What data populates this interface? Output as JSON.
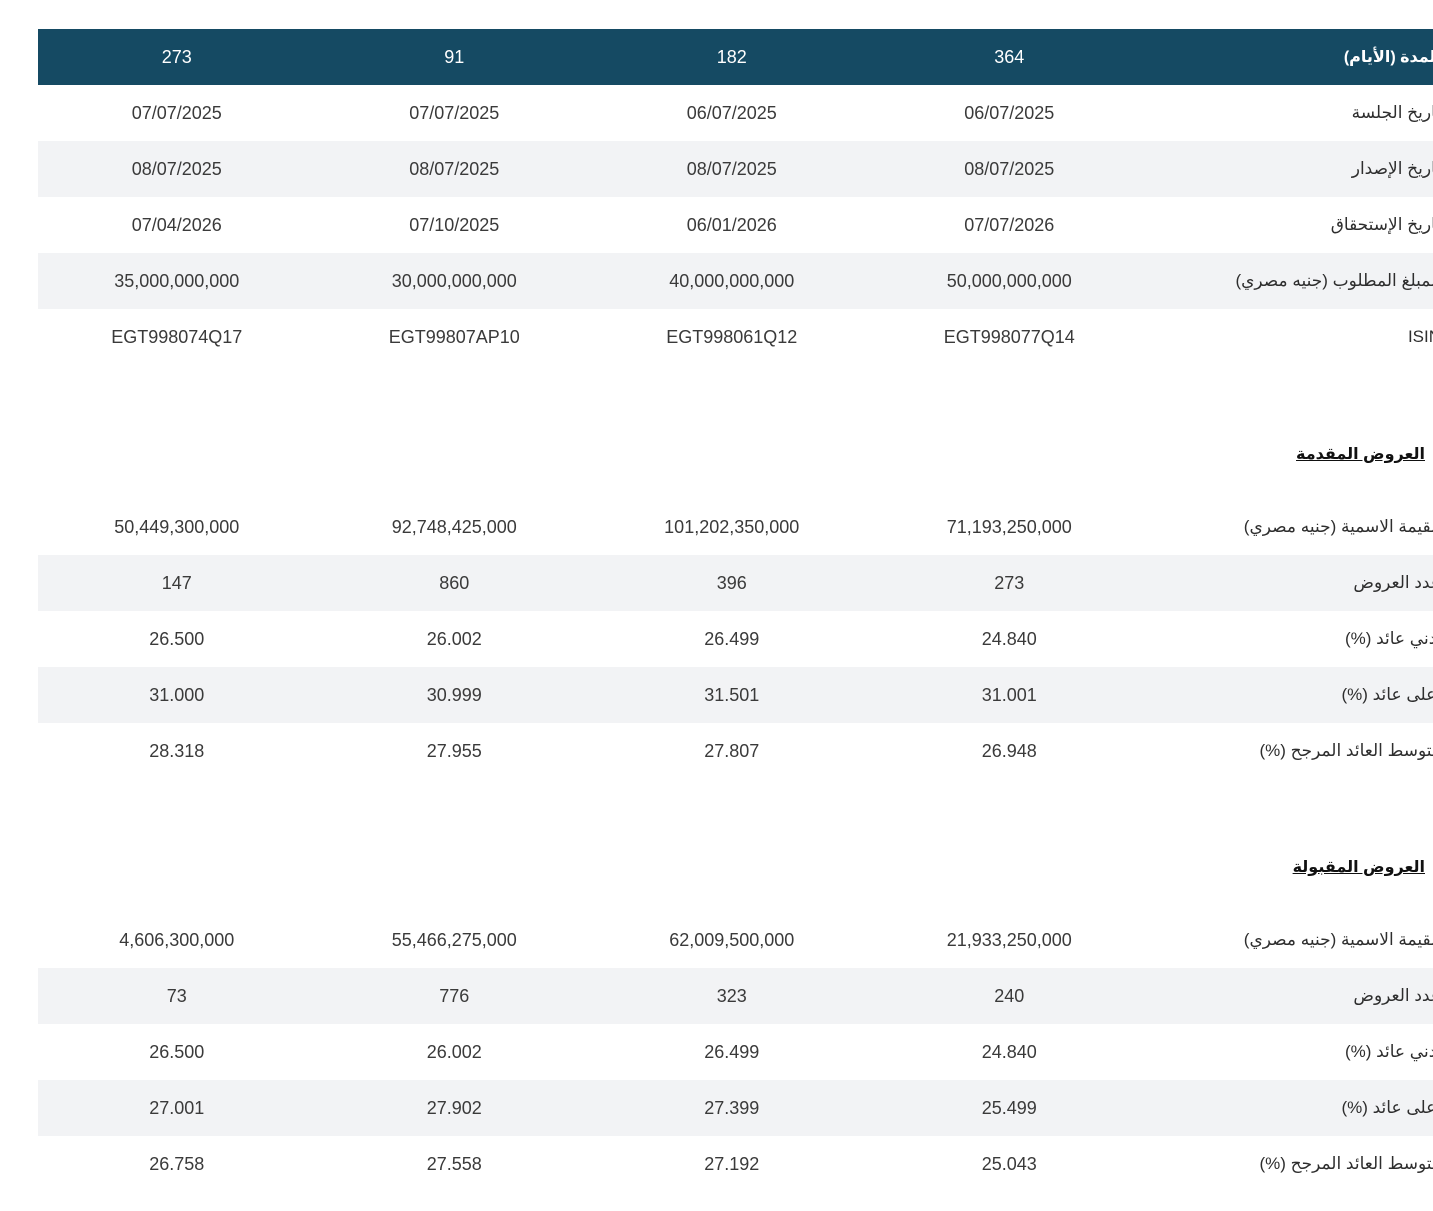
{
  "main_table": {
    "header": {
      "label": "المدة (الأيام)",
      "values": [
        "364",
        "182",
        "91",
        "273"
      ]
    },
    "rows": [
      {
        "label": "تاريخ الجلسة",
        "values": [
          "06/07/2025",
          "06/07/2025",
          "07/07/2025",
          "07/07/2025"
        ]
      },
      {
        "label": "تاريخ الإصدار",
        "values": [
          "08/07/2025",
          "08/07/2025",
          "08/07/2025",
          "08/07/2025"
        ]
      },
      {
        "label": "تاريخ الإستحقاق",
        "values": [
          "07/07/2026",
          "06/01/2026",
          "07/10/2025",
          "07/04/2026"
        ]
      },
      {
        "label": "المبلغ المطلوب (جنيه مصري)",
        "values": [
          "50,000,000,000",
          "40,000,000,000",
          "30,000,000,000",
          "35,000,000,000"
        ]
      },
      {
        "label": "ISIN",
        "values": [
          "EGT998077Q14",
          "EGT998061Q12",
          "EGT99807AP10",
          "EGT998074Q17"
        ]
      }
    ]
  },
  "offered": {
    "title": "العروض المقدمة",
    "rows": [
      {
        "label": "القيمة الاسمية (جنيه مصري)",
        "values": [
          "71,193,250,000",
          "101,202,350,000",
          "92,748,425,000",
          "50,449,300,000"
        ]
      },
      {
        "label": "عدد العروض",
        "values": [
          "273",
          "396",
          "860",
          "147"
        ]
      },
      {
        "label": "أدني عائد (%)",
        "values": [
          "24.840",
          "26.499",
          "26.002",
          "26.500"
        ]
      },
      {
        "label": "اعلى عائد (%)",
        "values": [
          "31.001",
          "31.501",
          "30.999",
          "31.000"
        ]
      },
      {
        "label": "متوسط العائد المرجح (%)",
        "values": [
          "26.948",
          "27.807",
          "27.955",
          "28.318"
        ]
      }
    ]
  },
  "accepted": {
    "title": "العروض المقبولة",
    "rows": [
      {
        "label": "القيمة الاسمية (جنيه مصري)",
        "values": [
          "21,933,250,000",
          "62,009,500,000",
          "55,466,275,000",
          "4,606,300,000"
        ]
      },
      {
        "label": "عدد العروض",
        "values": [
          "240",
          "323",
          "776",
          "73"
        ]
      },
      {
        "label": "أدني عائد (%)",
        "values": [
          "24.840",
          "26.499",
          "26.002",
          "26.500"
        ]
      },
      {
        "label": "اعلى عائد (%)",
        "values": [
          "25.499",
          "27.399",
          "27.902",
          "27.001"
        ]
      },
      {
        "label": "متوسط العائد المرجح (%)",
        "values": [
          "25.043",
          "27.192",
          "27.558",
          "26.758"
        ]
      }
    ]
  }
}
